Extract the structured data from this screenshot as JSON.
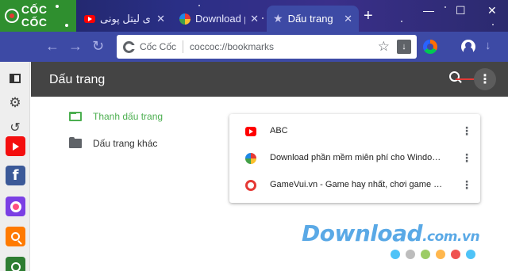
{
  "logo": {
    "text": "CỐC CỐC"
  },
  "tabs": [
    {
      "label": "مای لیتل پونی",
      "favicon": "youtube-icon"
    },
    {
      "label": "Download phần",
      "favicon": "download-site-icon"
    },
    {
      "label": "Dấu trang",
      "favicon": "star-icon",
      "active": true
    }
  ],
  "window_controls": {
    "minimize": "—",
    "maximize": "☐",
    "close": "✕"
  },
  "toolbar": {
    "back": "←",
    "forward": "→",
    "reload": "↻",
    "site_name": "Cốc Cốc",
    "url": "coccoc://bookmarks",
    "bookmark_star": "☆",
    "download_arrow": "↓"
  },
  "sidebar": {
    "items": [
      {
        "name": "side-panel-icon"
      },
      {
        "name": "settings-icon"
      },
      {
        "name": "history-icon"
      },
      {
        "name": "youtube-app-icon",
        "color": "#f40f0f"
      },
      {
        "name": "facebook-app-icon",
        "color": "#3b5998",
        "glyph": "f"
      },
      {
        "name": "music-app-icon",
        "color": "#7b3fe4"
      },
      {
        "name": "search-app-icon",
        "color": "#ff7a00"
      },
      {
        "name": "green-app-icon",
        "color": "#2e7d32"
      }
    ]
  },
  "header": {
    "title": "Dấu trang",
    "more_glyph": "⋮"
  },
  "folders": [
    {
      "label": "Thanh dấu trang",
      "active": true
    },
    {
      "label": "Dấu trang khác",
      "active": false
    }
  ],
  "bookmarks": [
    {
      "title": "ABC",
      "favicon": "youtube-icon"
    },
    {
      "title": "Download phần mềm miễn phí cho Windows, Mac, iOS,...",
      "favicon": "download-site-icon"
    },
    {
      "title": "GameVui.vn - Game hay nhất, chơi game online miễn phí",
      "favicon": "gamevui-icon"
    }
  ],
  "watermark": {
    "text": "Download",
    "suffix": ".com.vn",
    "dot_colors": [
      "#4fc3f7",
      "#bdbdbd",
      "#9ccc65",
      "#ffb74d",
      "#ef5350",
      "#4fc3f7"
    ]
  },
  "colors": {
    "titlebar": "#2a2f86",
    "toolbar": "#3d4aa5",
    "header": "#444444",
    "accent_green": "#4caf50",
    "arrow_red": "#e53935"
  }
}
